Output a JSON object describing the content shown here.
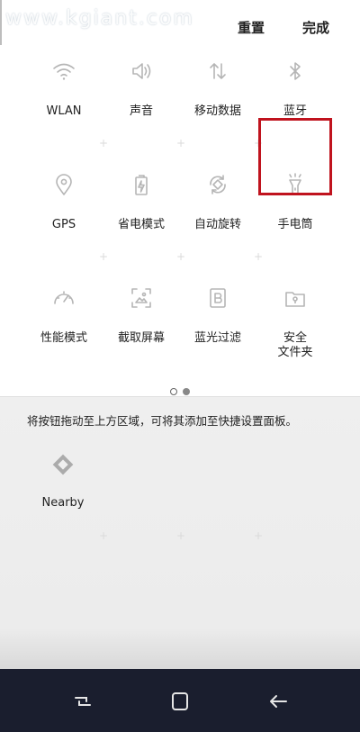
{
  "watermark": "www.kgiant.com",
  "header": {
    "reset_label": "重置",
    "done_label": "完成"
  },
  "active_tiles": [
    {
      "label": "WLAN",
      "icon": "wifi-icon"
    },
    {
      "label": "声音",
      "icon": "speaker-icon"
    },
    {
      "label": "移动数据",
      "icon": "mobile-data-icon"
    },
    {
      "label": "蓝牙",
      "icon": "bluetooth-icon"
    },
    {
      "label": "GPS",
      "icon": "location-pin-icon"
    },
    {
      "label": "省电模式",
      "icon": "battery-saver-icon"
    },
    {
      "label": "自动旋转",
      "icon": "auto-rotate-icon"
    },
    {
      "label": "手电筒",
      "icon": "flashlight-icon",
      "highlighted": true
    },
    {
      "label": "性能模式",
      "icon": "speedometer-icon"
    },
    {
      "label": "截取屏幕",
      "icon": "screenshot-icon"
    },
    {
      "label": "蓝光过滤",
      "icon": "blue-light-filter-icon"
    },
    {
      "label": "安全\n文件夹",
      "icon": "secure-folder-icon"
    }
  ],
  "page_indicator": {
    "pages": 2,
    "current": 1
  },
  "hint": "将按钮拖动至上方区域，可将其添加至快捷设置面板。",
  "available_tiles": [
    {
      "label": "Nearby",
      "icon": "nearby-icon"
    }
  ],
  "highlight_color": "#c0131e",
  "navbar_color": "#1a1e2e"
}
